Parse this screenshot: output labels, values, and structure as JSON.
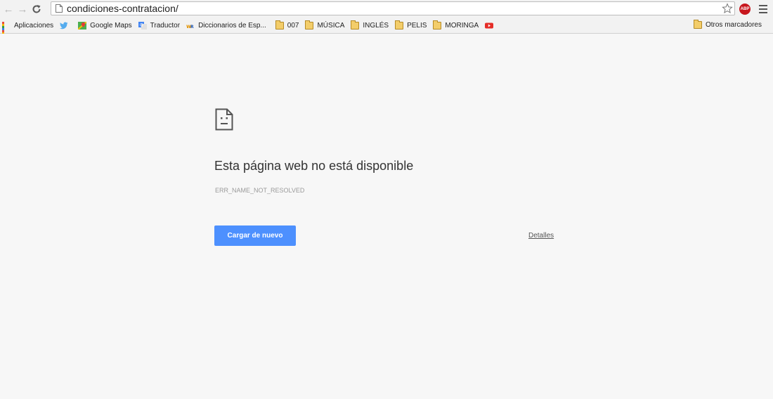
{
  "toolbar": {
    "url": "condiciones-contratacion/",
    "back_icon": "back-arrow-icon",
    "forward_icon": "forward-arrow-icon",
    "reload_icon": "reload-icon",
    "abp_label": "ABP"
  },
  "bookmarks": {
    "items": [
      {
        "label": "Aplicaciones",
        "icon": "apps-grid-icon"
      },
      {
        "label": "",
        "icon": "twitter-icon"
      },
      {
        "label": "Google Maps",
        "icon": "google-maps-icon"
      },
      {
        "label": "Traductor",
        "icon": "google-translate-icon"
      },
      {
        "label": "Diccionarios de Esp...",
        "icon": "wordreference-icon"
      },
      {
        "label": "007",
        "icon": "folder-icon"
      },
      {
        "label": "MÚSICA",
        "icon": "folder-icon"
      },
      {
        "label": "INGLÉS",
        "icon": "folder-icon"
      },
      {
        "label": "PELIS",
        "icon": "folder-icon"
      },
      {
        "label": "MORINGA",
        "icon": "folder-icon"
      },
      {
        "label": "",
        "icon": "youtube-icon"
      }
    ],
    "other_label": "Otros marcadores"
  },
  "error": {
    "title": "Esta página web no está disponible",
    "code": "ERR_NAME_NOT_RESOLVED",
    "reload_button": "Cargar de nuevo",
    "details_link": "Detalles"
  },
  "colors": {
    "button_blue": "#4d90fe",
    "page_background": "#f7f7f7"
  }
}
